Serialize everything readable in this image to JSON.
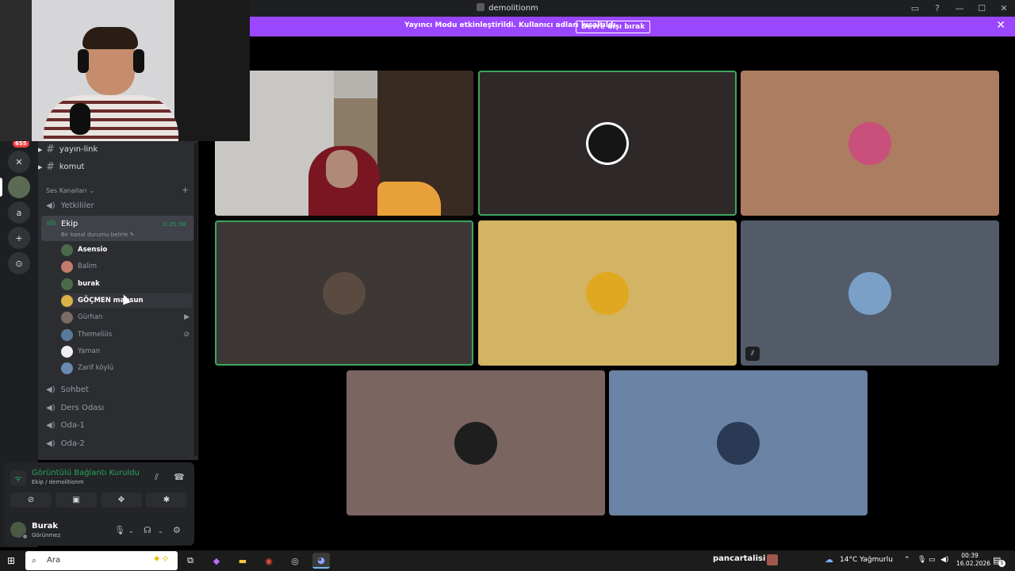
{
  "window": {
    "title": "demolitionm",
    "controls": [
      "▭",
      "?",
      "—",
      "☐",
      "✕"
    ]
  },
  "banner": {
    "text": "Yayıncı Modu etkinleştirildi. Kullanıcı adları kısaltıldı.",
    "button_label": "Devre dışı bırak",
    "close_glyph": "✕"
  },
  "servers": {
    "badge": "655",
    "items": [
      "✕",
      "",
      "a",
      "+",
      "⊙"
    ]
  },
  "channels": {
    "text_channels": [
      {
        "name": "yayın-link",
        "hash": "#"
      },
      {
        "name": "komut",
        "hash": "#"
      }
    ],
    "voice_section": {
      "label": "Ses Kanalları ⌄",
      "add": "+"
    },
    "voice_channels_top": [
      {
        "name": "Yetkililer"
      }
    ],
    "active_voice": {
      "name": "Ekip",
      "timer": "3:25:58",
      "status": "Bir kanal durumu belirle ✎",
      "members": [
        {
          "name": "Asensio",
          "bright": true,
          "color": "#4a6b4a",
          "icon": ""
        },
        {
          "name": "Balim",
          "bright": false,
          "color": "#c47a6a",
          "icon": ""
        },
        {
          "name": "burak",
          "bright": true,
          "color": "#4a6b4a",
          "icon": ""
        },
        {
          "name": "GÖÇMEN mahsun",
          "bright": true,
          "color": "#d9b34a",
          "icon": ""
        },
        {
          "name": "Gürhan",
          "bright": false,
          "color": "#7a6d66",
          "icon": "▶"
        },
        {
          "name": "Themeliiis",
          "bright": false,
          "color": "#5a7a9a",
          "icon": "⊘"
        },
        {
          "name": "Yaman",
          "bright": false,
          "color": "#f0f0f0",
          "icon": ""
        },
        {
          "name": "Zarif köylü",
          "bright": false,
          "color": "#6a8ab0",
          "icon": ""
        }
      ]
    },
    "voice_channels_bottom": [
      {
        "name": "Sohbet"
      },
      {
        "name": "Ders Odası"
      },
      {
        "name": "Oda-1"
      },
      {
        "name": "Oda-2"
      }
    ]
  },
  "connection": {
    "title": "Görüntülü Bağlantı Kuruldu",
    "subtitle": "Ekip / demolitionm",
    "actions": [
      "⊘",
      "▣",
      "✥",
      "✱"
    ]
  },
  "user": {
    "name": "Burak",
    "status": "Görünmez"
  },
  "tiles": [
    {
      "kind": "camera",
      "speaking": false
    },
    {
      "kind": "avatar",
      "bg": "#2f2828",
      "avatar": "#151515",
      "speaking": true,
      "muted": false
    },
    {
      "kind": "avatar",
      "bg": "#ad7d61",
      "avatar": "#c8507a",
      "speaking": false,
      "muted": false
    },
    {
      "kind": "avatar",
      "bg": "#3d3835",
      "avatar": "#5a4a40",
      "speaking": true,
      "muted": false
    },
    {
      "kind": "avatar",
      "bg": "#d3b464",
      "avatar": "#e0a820",
      "speaking": false,
      "muted": false
    },
    {
      "kind": "avatar",
      "bg": "#525b67",
      "avatar": "#7aa0c8",
      "speaking": false,
      "muted": true
    },
    {
      "kind": "avatar",
      "bg": "#7a6561",
      "avatar": "#1e1e1e",
      "speaking": false,
      "muted": false
    },
    {
      "kind": "avatar",
      "bg": "#6b83a5",
      "avatar": "#2a3a55",
      "speaking": false,
      "muted": false
    }
  ],
  "taskbar": {
    "search_placeholder": "Ara",
    "stream_label": "pancartalisi :",
    "weather": "14°C  Yağmurlu",
    "time": "00:39",
    "date": "16.02.2026",
    "notif_count": "5"
  }
}
